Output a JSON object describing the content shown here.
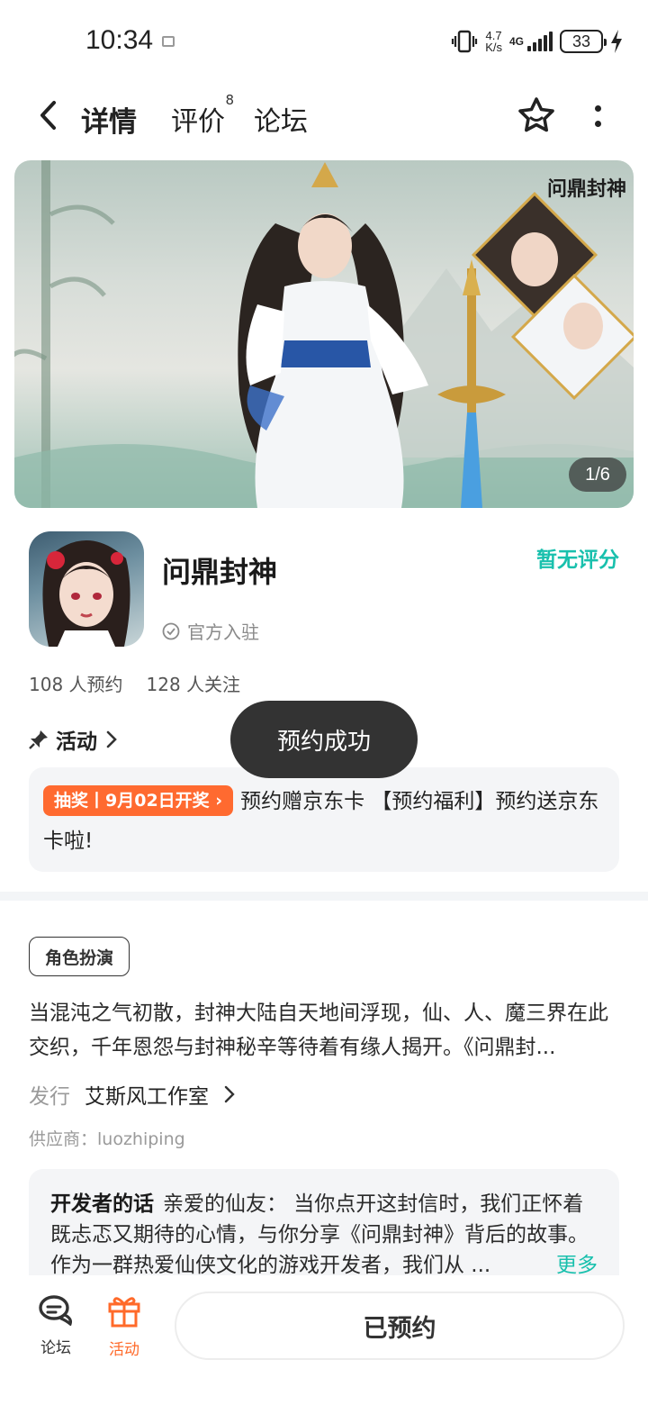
{
  "status_bar": {
    "time": "10:34",
    "net_speed_value": "4.7",
    "net_speed_unit": "K/s",
    "network": "4G",
    "battery": "33"
  },
  "nav": {
    "tabs": [
      {
        "label": "详情",
        "active": true
      },
      {
        "label": "评价",
        "badge": "8"
      },
      {
        "label": "论坛"
      }
    ],
    "accent_color": "#19c8b8"
  },
  "banner": {
    "counter": "1/6",
    "logo_text": "问鼎封神"
  },
  "game": {
    "name": "问鼎封神",
    "rating_text": "暂无评分",
    "official_label": "官方入驻",
    "reservations": "108 人预约",
    "followers": "128 人关注"
  },
  "activity": {
    "header": "活动",
    "tag": "抽奖丨9月02日开奖",
    "text": "预约赠京东卡 【预约福利】预约送京东卡啦!"
  },
  "toast": "预约成功",
  "details": {
    "genre_tag": "角色扮演",
    "description": "当混沌之气初散，封神大陆自天地间浮现，仙、人、魔三界在此交织，千年恩怨与封神秘辛等待着有缘人揭开。《问鼎封...",
    "publisher_label": "发行",
    "publisher_value": "艾斯风工作室",
    "supplier": "供应商：luozhiping"
  },
  "developer_note": {
    "title": "开发者的话",
    "text": "亲爱的仙友： 当你点开这封信时，我们正怀着既忐忑又期待的心情，与你分享《问鼎封神》背后的故事。作为一群热爱仙侠文化的游戏开发者，我们从 ...",
    "more": "更多"
  },
  "bottom_bar": {
    "forum_label": "论坛",
    "activity_label": "活动",
    "reserved_button": "已预约",
    "activity_color": "#ff6a2a"
  }
}
